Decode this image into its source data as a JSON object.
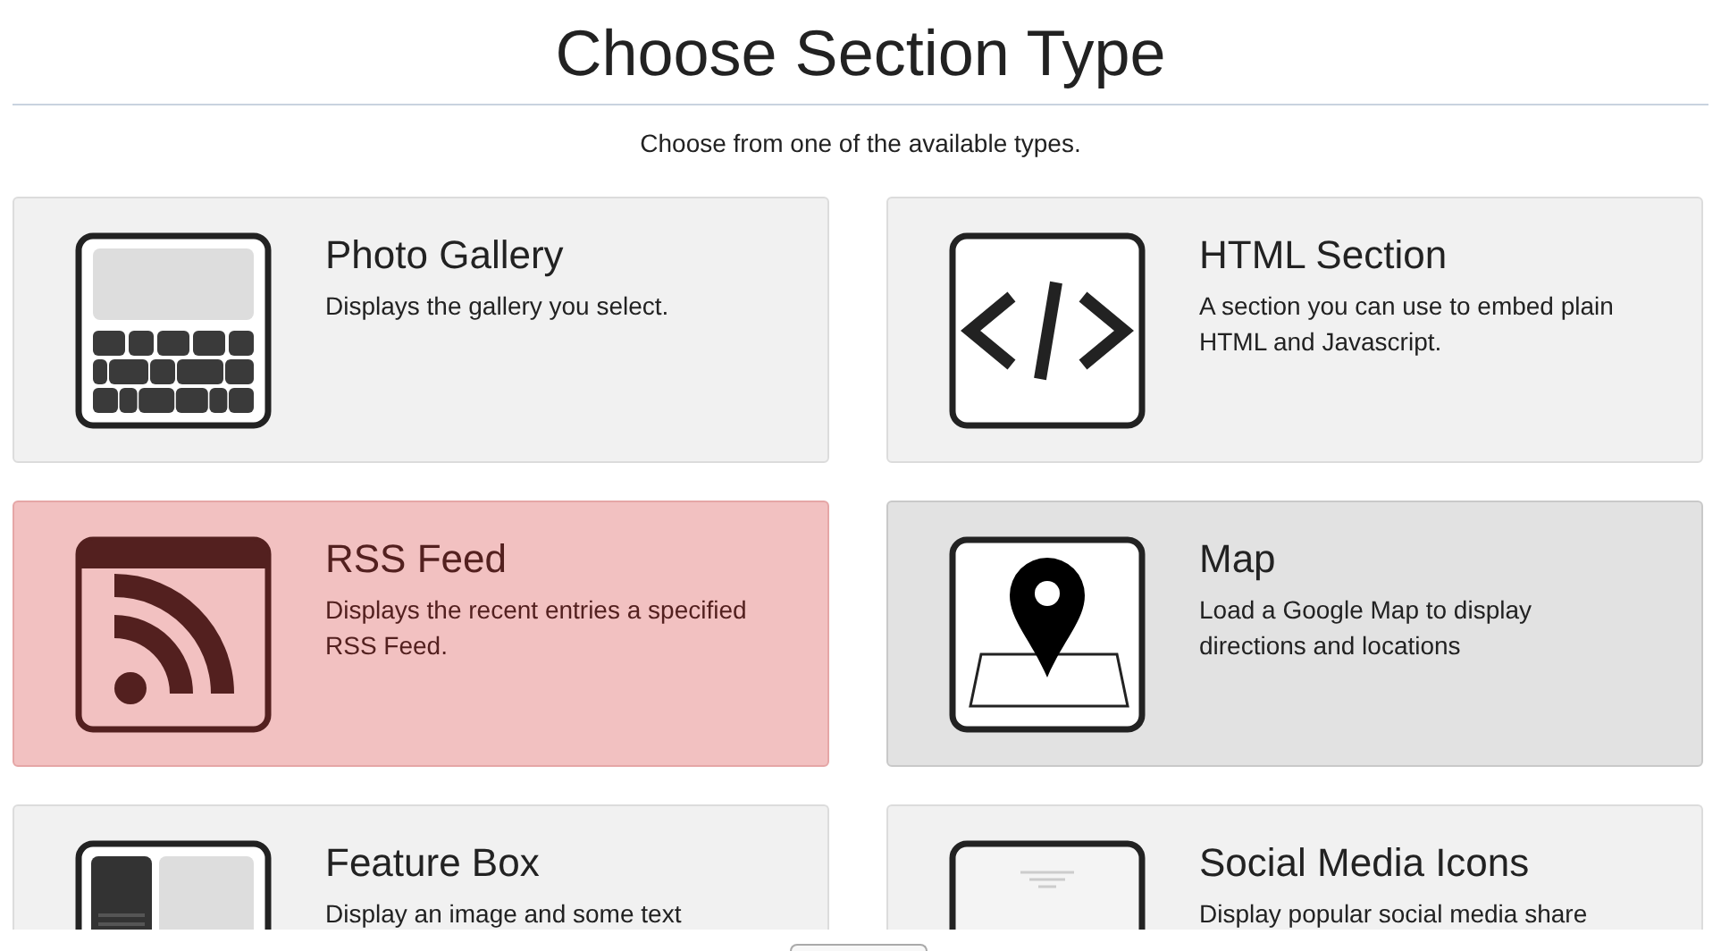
{
  "header": {
    "title": "Choose Section Type",
    "subtitle": "Choose from one of the available types."
  },
  "section_types": [
    {
      "kind": "gallery",
      "title": "Photo Gallery",
      "description": "Displays the gallery you select.",
      "selected": false,
      "hovered": false
    },
    {
      "kind": "code",
      "title": "HTML Section",
      "description": "A section you can use to embed plain\nHTML and Javascript.",
      "selected": false,
      "hovered": false
    },
    {
      "kind": "rss",
      "title": "RSS Feed",
      "description": "Displays the recent entries a specified\nRSS Feed.",
      "selected": true,
      "hovered": false
    },
    {
      "kind": "map",
      "title": "Map",
      "description": "Load a Google Map to display\ndirections and locations",
      "selected": false,
      "hovered": true
    },
    {
      "kind": "feature",
      "title": "Feature Box",
      "description": "Display an image and some text",
      "selected": false,
      "hovered": false
    },
    {
      "kind": "social",
      "title": "Social Media Icons",
      "description": "Display popular social media share",
      "selected": false,
      "hovered": false
    }
  ]
}
